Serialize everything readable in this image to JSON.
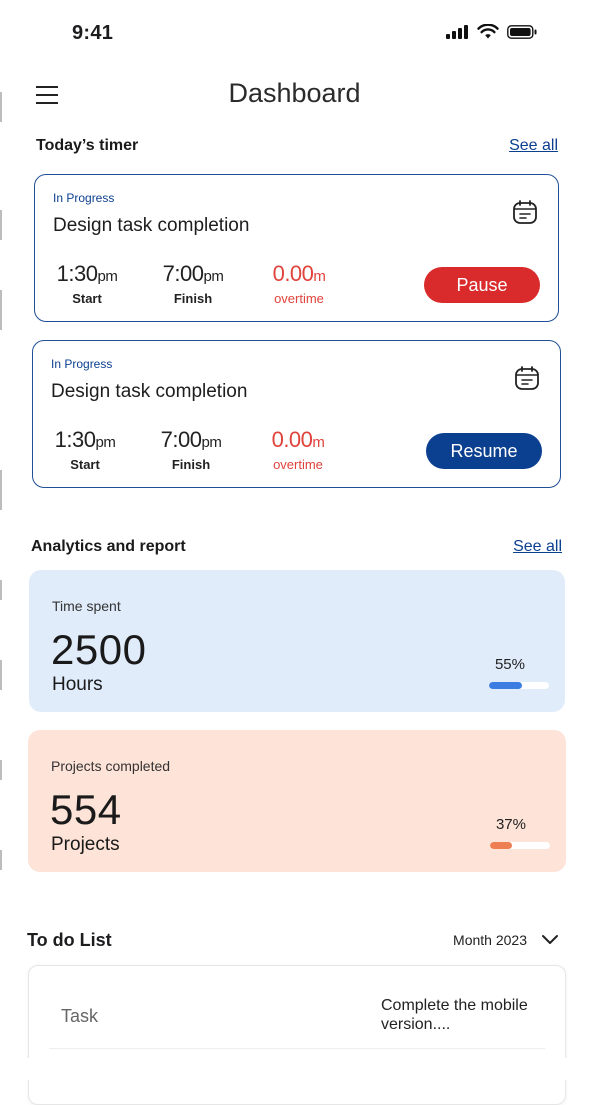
{
  "status_bar": {
    "time": "9:41"
  },
  "header": {
    "title": "Dashboard"
  },
  "todays_timer": {
    "title": "Today’s timer",
    "see_all": "See all",
    "cards": [
      {
        "status": "In Progress",
        "task": "Design task completion",
        "start_time": "1:30",
        "start_suffix": "pm",
        "start_label": "Start",
        "finish_time": "7:00",
        "finish_suffix": "pm",
        "finish_label": "Finish",
        "overtime_value": "0.00",
        "overtime_suffix": "m",
        "overtime_label": "overtime",
        "button_label": "Pause",
        "button_color": "#d92b2b"
      },
      {
        "status": "In Progress",
        "task": "Design task completion",
        "start_time": "1:30",
        "start_suffix": "pm",
        "start_label": "Start",
        "finish_time": "7:00",
        "finish_suffix": "pm",
        "finish_label": "Finish",
        "overtime_value": "0.00",
        "overtime_suffix": "m",
        "overtime_label": "overtime",
        "button_label": "Resume",
        "button_color": "#0b3f8f"
      }
    ]
  },
  "analytics": {
    "title": "Analytics and report",
    "see_all": "See all",
    "cards": [
      {
        "label": "Time spent",
        "value": "2500",
        "unit": "Hours",
        "percent": "55%",
        "progress": 0.55,
        "bg": "#e1ecfb",
        "bar_color": "#3b7de0"
      },
      {
        "label": "Projects completed",
        "value": "554",
        "unit": "Projects",
        "percent": "37%",
        "progress": 0.37,
        "bg": "#fde3d8",
        "bar_color": "#ee7f52"
      }
    ]
  },
  "todo": {
    "title": "To do List",
    "period": "Month 2023",
    "task_label": "Task",
    "task_value": "Complete the mobile version...."
  },
  "colors": {
    "accent_blue": "#0b3f8f",
    "danger_red": "#d92b2b",
    "overtime_red": "#e0433b"
  }
}
